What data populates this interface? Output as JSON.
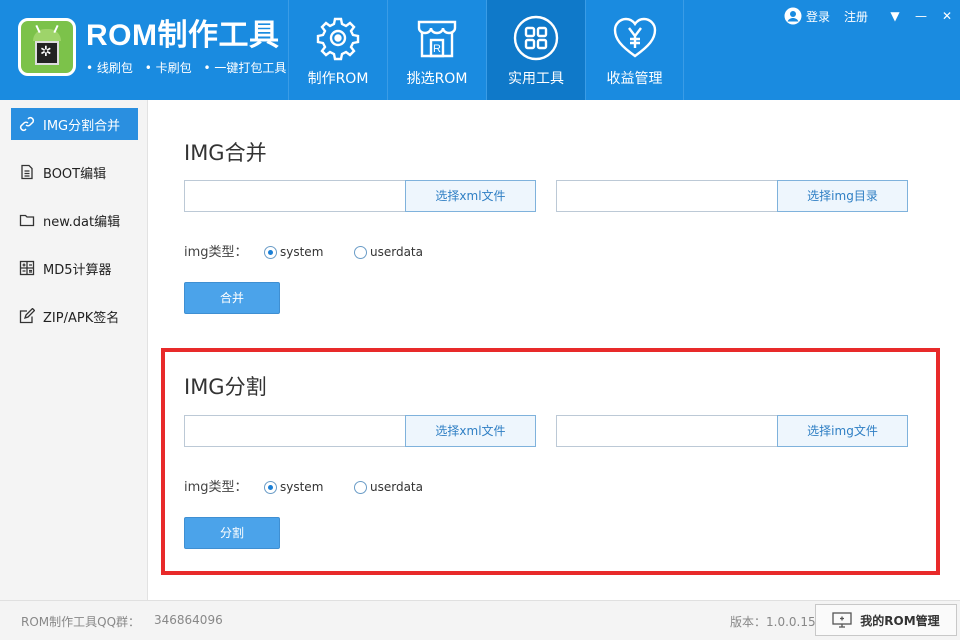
{
  "app": {
    "title": "ROM制作工具",
    "features": [
      "• 线刷包",
      "• 卡刷包",
      "• 一键打包工具"
    ]
  },
  "topbar": {
    "login": "登录",
    "register": "注册"
  },
  "nav": [
    {
      "label": "制作ROM",
      "icon": "gear-icon"
    },
    {
      "label": "挑选ROM",
      "icon": "store-icon"
    },
    {
      "label": "实用工具",
      "icon": "grid-icon",
      "active": true
    },
    {
      "label": "收益管理",
      "icon": "heart-yen-icon"
    }
  ],
  "sidebar": [
    {
      "label": "IMG分割合并",
      "icon": "link-icon",
      "active": true
    },
    {
      "label": "BOOT编辑",
      "icon": "document-icon"
    },
    {
      "label": "new.dat编辑",
      "icon": "folder-icon"
    },
    {
      "label": "MD5计算器",
      "icon": "calculator-icon"
    },
    {
      "label": "ZIP/APK签名",
      "icon": "edit-icon"
    }
  ],
  "merge": {
    "title": "IMG合并",
    "xml_value": "",
    "xml_button": "选择xml文件",
    "img_value": "",
    "img_button": "选择img目录",
    "type_label": "img类型：",
    "option_system": "system",
    "option_userdata": "userdata",
    "selected": "system",
    "action": "合并"
  },
  "split": {
    "title": "IMG分割",
    "xml_value": "",
    "xml_button": "选择xml文件",
    "img_value": "",
    "img_button": "选择img文件",
    "type_label": "img类型：",
    "option_system": "system",
    "option_userdata": "userdata",
    "selected": "system",
    "action": "分割"
  },
  "footer": {
    "qq_label": "ROM制作工具QQ群：",
    "qq_number": "346864096",
    "version": "版本：1.0.0.15",
    "manage_button": "我的ROM管理"
  },
  "colors": {
    "header_blue": "#1a8be0",
    "active_nav": "#0f79c9",
    "sidebar_active": "#2a8fe0",
    "highlight_red": "#e82a2a",
    "action_button": "#4ba3ea"
  }
}
